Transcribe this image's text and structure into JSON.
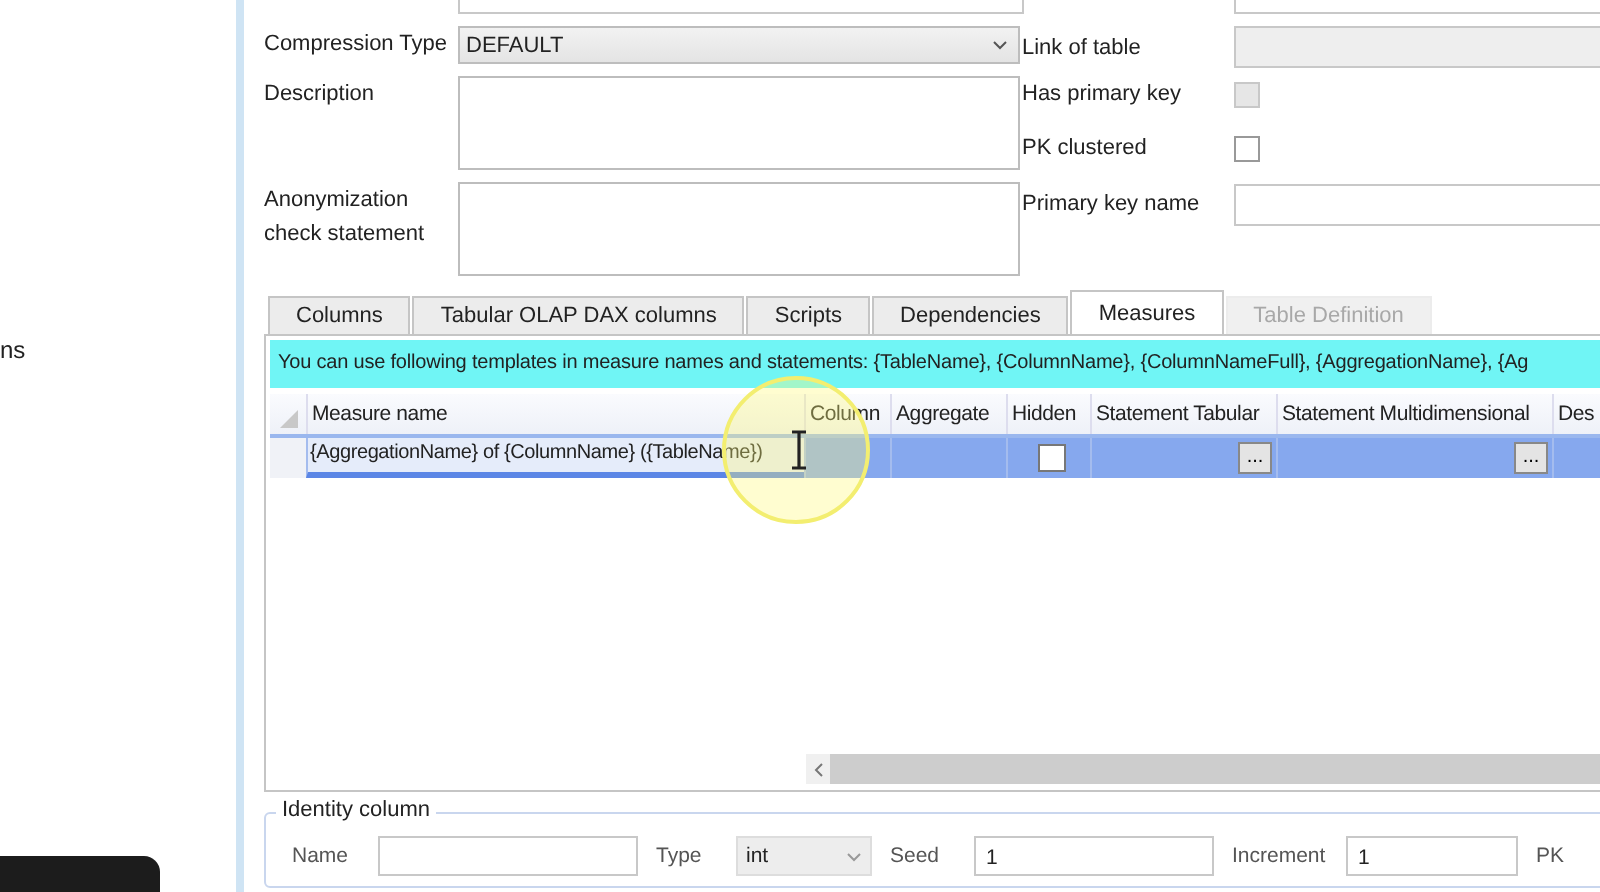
{
  "sidebar": {
    "text": "ns"
  },
  "form": {
    "left": [
      {
        "kind": "select",
        "label": "Compression Type",
        "value": "DEFAULT"
      },
      {
        "kind": "textarea",
        "label": "Description"
      },
      {
        "kind": "textarea",
        "label": "Anonymization check statement"
      }
    ],
    "right": [
      {
        "kind": "text",
        "label": "Link of table",
        "disabled": true
      },
      {
        "kind": "checkbox",
        "label": "Has primary key",
        "checked": false,
        "disabled": true
      },
      {
        "kind": "checkbox",
        "label": "PK clustered",
        "checked": false,
        "disabled": false
      },
      {
        "kind": "text",
        "label": "Primary key name",
        "disabled": false
      }
    ]
  },
  "tabs": [
    {
      "label": "Columns",
      "selected": false,
      "disabled": false
    },
    {
      "label": "Tabular OLAP DAX columns",
      "selected": false,
      "disabled": false
    },
    {
      "label": "Scripts",
      "selected": false,
      "disabled": false
    },
    {
      "label": "Dependencies",
      "selected": false,
      "disabled": false
    },
    {
      "label": "Measures",
      "selected": true,
      "disabled": false
    },
    {
      "label": "Table Definition",
      "selected": false,
      "disabled": true
    }
  ],
  "info_banner": "You can use following templates in measure names and statements: {TableName}, {ColumnName}, {ColumnNameFull}, {AggregationName}, {Ag",
  "grid": {
    "columns": [
      "Measure name",
      "Column",
      "Aggregate",
      "Hidden",
      "Statement Tabular",
      "Statement Multidimensional",
      "Des"
    ],
    "rows": [
      {
        "selected": true,
        "cells": [
          {
            "kind": "edit",
            "value": "{AggregationName} of {ColumnName} ({TableName})"
          },
          {
            "kind": "text"
          },
          {
            "kind": "text"
          },
          {
            "kind": "checkbox",
            "checked": false
          },
          {
            "kind": "button",
            "label": "..."
          },
          {
            "kind": "button",
            "label": "..."
          },
          {
            "kind": "text"
          }
        ]
      }
    ]
  },
  "identity": {
    "legend": "Identity column",
    "fields": [
      {
        "kind": "text",
        "label": "Name"
      },
      {
        "kind": "select",
        "label": "Type",
        "value": "int"
      },
      {
        "kind": "text",
        "label": "Seed",
        "value": "1"
      },
      {
        "kind": "text",
        "label": "Increment",
        "value": "1"
      },
      {
        "kind": "label",
        "label": "PK"
      }
    ]
  }
}
